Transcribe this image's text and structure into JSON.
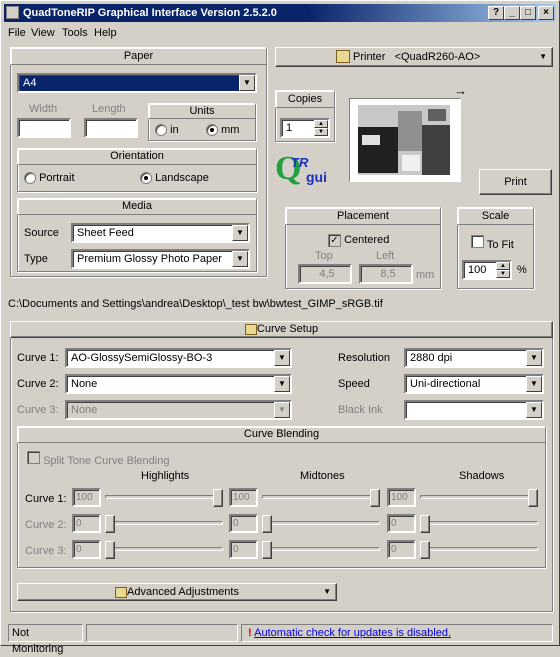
{
  "title": "QuadToneRIP Graphical Interface Version 2.5.2.0",
  "menu": [
    "File",
    "View",
    "Tools",
    "Help"
  ],
  "paper": {
    "heading": "Paper",
    "size": "A4",
    "width_label": "Width",
    "length_label": "Length",
    "width_value": "",
    "length_value": "",
    "units_heading": "Units",
    "unit_in": "in",
    "unit_mm": "mm",
    "units_selected": "mm"
  },
  "orientation": {
    "heading": "Orientation",
    "portrait": "Portrait",
    "landscape": "Landscape",
    "selected": "Landscape"
  },
  "media": {
    "heading": "Media",
    "source_label": "Source",
    "source_value": "Sheet Feed",
    "type_label": "Type",
    "type_value": "Premium Glossy Photo Paper"
  },
  "printer": {
    "label": "Printer",
    "name": "<QuadR260-AO>",
    "icon": "printer-icon"
  },
  "copies": {
    "heading": "Copies",
    "value": "1"
  },
  "logo": {
    "q": "Q",
    "tr": "TR",
    "gui": "gui"
  },
  "print_label": "Print",
  "placement": {
    "heading": "Placement",
    "centered_label": "Centered",
    "centered": true,
    "top_label": "Top",
    "left_label": "Left",
    "top_value": "4,5",
    "left_value": "8,5",
    "unit": "mm"
  },
  "scale": {
    "heading": "Scale",
    "tofit_label": "To Fit",
    "tofit": false,
    "value": "100",
    "unit": "%"
  },
  "file_path": "C:\\Documents and Settings\\andrea\\Desktop\\_test bw\\bwtest_GIMP_sRGB.tif",
  "curve_setup": {
    "label": "Curve Setup",
    "curve1_label": "Curve 1:",
    "curve1_value": "AO-GlossySemiGlossy-BO-3",
    "curve2_label": "Curve 2:",
    "curve2_value": "None",
    "curve3_label": "Curve 3:",
    "curve3_value": "None",
    "resolution_label": "Resolution",
    "resolution_value": "2880 dpi",
    "speed_label": "Speed",
    "speed_value": "Uni-directional",
    "blackink_label": "Black Ink",
    "blackink_value": ""
  },
  "blending": {
    "heading": "Curve Blending",
    "split_label": "Split Tone Curve Blending",
    "col_highlights": "Highlights",
    "col_midtones": "Midtones",
    "col_shadows": "Shadows",
    "rows": [
      {
        "label": "Curve 1:",
        "values": [
          "100",
          "100",
          "100"
        ],
        "levels": [
          1,
          1,
          1
        ]
      },
      {
        "label": "Curve 2:",
        "values": [
          "0",
          "0",
          "0"
        ],
        "levels": [
          0,
          0,
          0
        ]
      },
      {
        "label": "Curve 3:",
        "values": [
          "0",
          "0",
          "0"
        ],
        "levels": [
          0,
          0,
          0
        ]
      }
    ]
  },
  "advanced_label": "Advanced Adjustments",
  "status": {
    "monitor": "Not Monitoring",
    "middle": "",
    "update_text": "Automatic check for updates is disabled."
  }
}
